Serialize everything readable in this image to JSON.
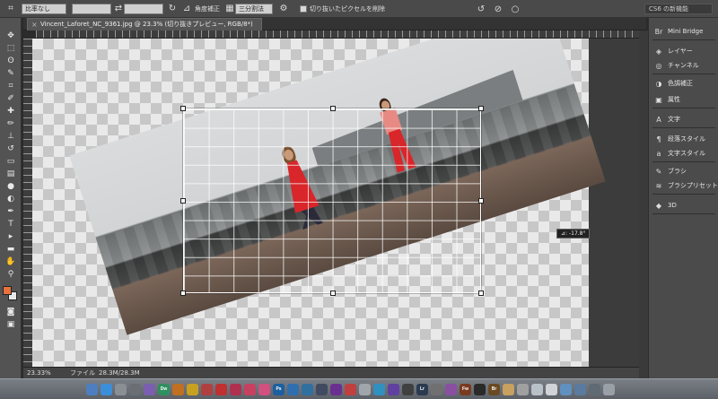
{
  "options_bar": {
    "ratio_value": "比率なし",
    "field_2": "",
    "field_3": "",
    "mode_label": "角度補正",
    "overlay_value": "三分割法",
    "delete_pixels_label": "切り抜いたピクセルを削除",
    "workspace": "CS6 の新機能"
  },
  "document_tab": {
    "title": "Vincent_Laforet_NC_9361.jpg @ 23.3% (切り抜きプレビュー, RGB/8*)"
  },
  "tools": [
    {
      "name": "move-tool-icon",
      "glyph": "✥"
    },
    {
      "name": "marquee-tool-icon",
      "glyph": "⬚"
    },
    {
      "name": "lasso-tool-icon",
      "glyph": "ʘ"
    },
    {
      "name": "quick-select-tool-icon",
      "glyph": "✎"
    },
    {
      "name": "crop-tool-icon",
      "glyph": "⌗"
    },
    {
      "name": "eyedropper-tool-icon",
      "glyph": "✐"
    },
    {
      "name": "healing-brush-tool-icon",
      "glyph": "✚"
    },
    {
      "name": "brush-tool-icon",
      "glyph": "✏"
    },
    {
      "name": "stamp-tool-icon",
      "glyph": "⊥"
    },
    {
      "name": "history-brush-tool-icon",
      "glyph": "↺"
    },
    {
      "name": "eraser-tool-icon",
      "glyph": "▭"
    },
    {
      "name": "gradient-tool-icon",
      "glyph": "▤"
    },
    {
      "name": "blur-tool-icon",
      "glyph": "●"
    },
    {
      "name": "dodge-tool-icon",
      "glyph": "◐"
    },
    {
      "name": "pen-tool-icon",
      "glyph": "✒"
    },
    {
      "name": "type-tool-icon",
      "glyph": "T"
    },
    {
      "name": "path-select-tool-icon",
      "glyph": "▸"
    },
    {
      "name": "shape-tool-icon",
      "glyph": "▬"
    },
    {
      "name": "hand-tool-icon",
      "glyph": "✋"
    },
    {
      "name": "zoom-tool-icon",
      "glyph": "⚲"
    }
  ],
  "colors": {
    "foreground": "#e8713c",
    "background": "#e8e8e8"
  },
  "canvas": {
    "angle_readout": "⊿: -17.8°",
    "rotation_deg": -17.8
  },
  "status_bar": {
    "zoom": "23.33%",
    "file_label": "ファイル",
    "file_size": "28.3M/28.3M"
  },
  "panels": [
    {
      "icon": "mini-bridge-icon",
      "glyph": "Br",
      "label": "Mini Bridge"
    },
    {
      "icon": "layers-icon",
      "glyph": "◈",
      "label": "レイヤー"
    },
    {
      "icon": "channels-icon",
      "glyph": "◎",
      "label": "チャンネル"
    },
    {
      "icon": "adjustments-icon",
      "glyph": "◑",
      "label": "色調補正"
    },
    {
      "icon": "properties-icon",
      "glyph": "▣",
      "label": "属性"
    },
    {
      "icon": "character-icon",
      "glyph": "A",
      "label": "文字"
    },
    {
      "icon": "paragraph-style-icon",
      "glyph": "¶",
      "label": "段落スタイル"
    },
    {
      "icon": "character-style-icon",
      "glyph": "a",
      "label": "文字スタイル"
    },
    {
      "icon": "brush-panel-icon",
      "glyph": "✎",
      "label": "ブラシ"
    },
    {
      "icon": "brush-preset-icon",
      "glyph": "≋",
      "label": "ブラシプリセット"
    },
    {
      "icon": "3d-icon",
      "glyph": "◆",
      "label": "3D"
    }
  ],
  "dock": [
    {
      "name": "finder-dock-icon",
      "label": "",
      "color": "#4d7fc0"
    },
    {
      "name": "safari-dock-icon",
      "label": "",
      "color": "#3a8fd8"
    },
    {
      "name": "app-dock-icon-1",
      "label": "",
      "color": "#8a8f96"
    },
    {
      "name": "app-dock-icon-2",
      "label": "",
      "color": "#6a6f76"
    },
    {
      "name": "app-dock-icon-3",
      "label": "",
      "color": "#7a5fb0"
    },
    {
      "name": "dreamweaver-dock-icon",
      "label": "Dw",
      "color": "#2f8f5f"
    },
    {
      "name": "app-dock-icon-4",
      "label": "",
      "color": "#c07020"
    },
    {
      "name": "app-dock-icon-5",
      "label": "",
      "color": "#c8a020"
    },
    {
      "name": "app-dock-icon-6",
      "label": "",
      "color": "#b04040"
    },
    {
      "name": "app-dock-icon-7",
      "label": "",
      "color": "#c03030"
    },
    {
      "name": "app-dock-icon-8",
      "label": "",
      "color": "#b03050"
    },
    {
      "name": "app-dock-icon-9",
      "label": "",
      "color": "#c84060"
    },
    {
      "name": "app-dock-icon-10",
      "label": "",
      "color": "#d05080"
    },
    {
      "name": "photoshop-dock-icon",
      "label": "Ps",
      "color": "#1c5f9f"
    },
    {
      "name": "app-dock-icon-11",
      "label": "",
      "color": "#2f6fb0"
    },
    {
      "name": "app-dock-icon-12",
      "label": "",
      "color": "#3070a0"
    },
    {
      "name": "app-dock-icon-13",
      "label": "",
      "color": "#404a60"
    },
    {
      "name": "app-dock-icon-14",
      "label": "",
      "color": "#6a3090"
    },
    {
      "name": "app-dock-icon-15",
      "label": "",
      "color": "#c04040"
    },
    {
      "name": "app-dock-icon-16",
      "label": "",
      "color": "#a0a6ac"
    },
    {
      "name": "app-dock-icon-17",
      "label": "",
      "color": "#3090c0"
    },
    {
      "name": "app-dock-icon-18",
      "label": "",
      "color": "#6040a0"
    },
    {
      "name": "app-dock-icon-19",
      "label": "",
      "color": "#404040"
    },
    {
      "name": "lightroom-dock-icon",
      "label": "Lr",
      "color": "#2a3a50"
    },
    {
      "name": "app-dock-icon-20",
      "label": "",
      "color": "#707070"
    },
    {
      "name": "app-dock-icon-21",
      "label": "",
      "color": "#8a4fa0"
    },
    {
      "name": "fireworks-dock-icon",
      "label": "Fw",
      "color": "#7a3a20"
    },
    {
      "name": "app-dock-icon-22",
      "label": "",
      "color": "#2a2a2a"
    },
    {
      "name": "bridge-dock-icon",
      "label": "Br",
      "color": "#6a4a20"
    },
    {
      "name": "app-dock-icon-23",
      "label": "",
      "color": "#c8a060"
    },
    {
      "name": "app-dock-icon-24",
      "label": "",
      "color": "#a0a0a0"
    },
    {
      "name": "app-dock-icon-25",
      "label": "",
      "color": "#b8c0c8"
    },
    {
      "name": "app-dock-icon-26",
      "label": "",
      "color": "#d0d4d8"
    },
    {
      "name": "app-dock-icon-27",
      "label": "",
      "color": "#6090c0"
    },
    {
      "name": "app-dock-icon-28",
      "label": "",
      "color": "#5a7aa0"
    },
    {
      "name": "app-dock-icon-29",
      "label": "",
      "color": "#606a74"
    },
    {
      "name": "trash-dock-icon",
      "label": "",
      "color": "#9aa0a8"
    }
  ]
}
